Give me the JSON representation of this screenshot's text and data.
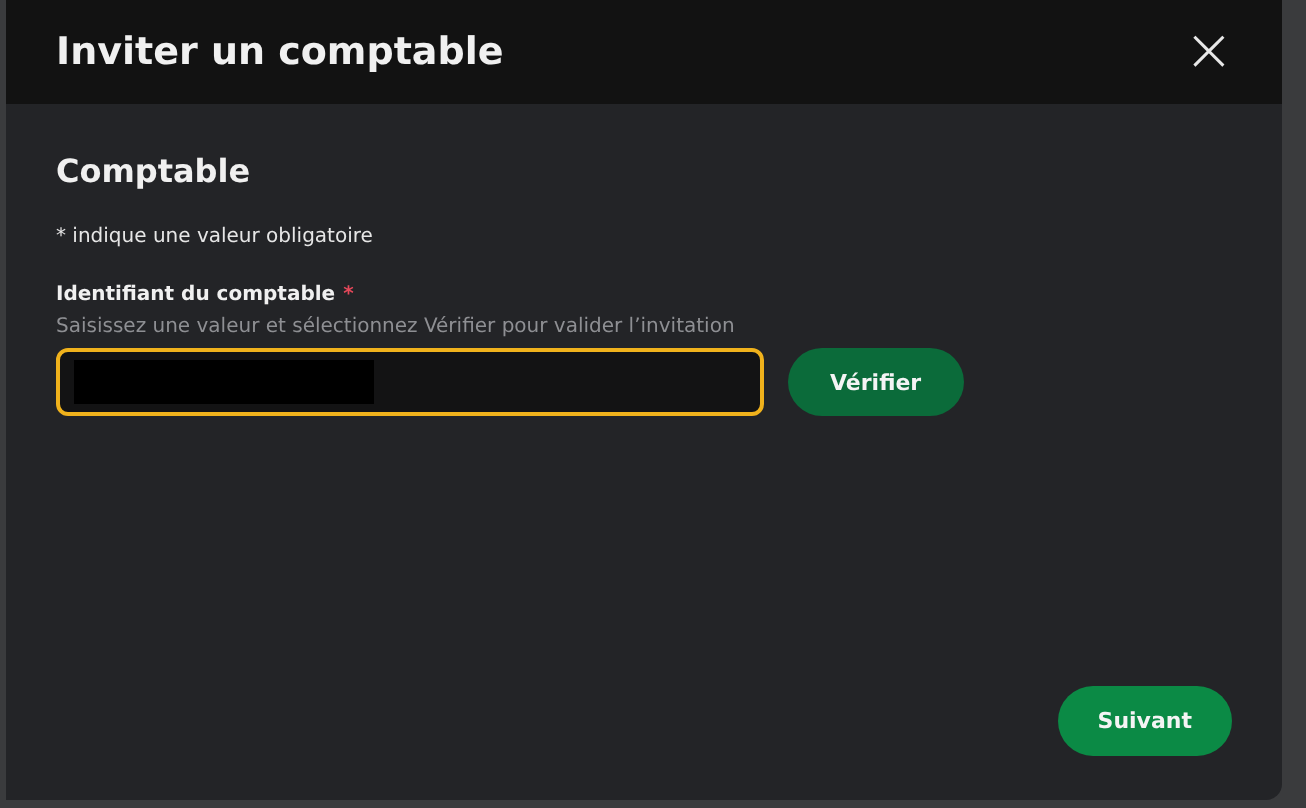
{
  "dialog": {
    "title": "Inviter un comptable",
    "close": "×"
  },
  "section": {
    "heading": "Comptable",
    "required_note": "* indique une valeur obligatoire"
  },
  "field": {
    "label": "Identifiant du comptable",
    "required_mark": "*",
    "hint": "Saisissez une valeur et sélectionnez Vérifier pour valider l’invitation",
    "focused": true,
    "redacted": true
  },
  "verify_button": "Vérifier",
  "next_button": "Suivant"
}
